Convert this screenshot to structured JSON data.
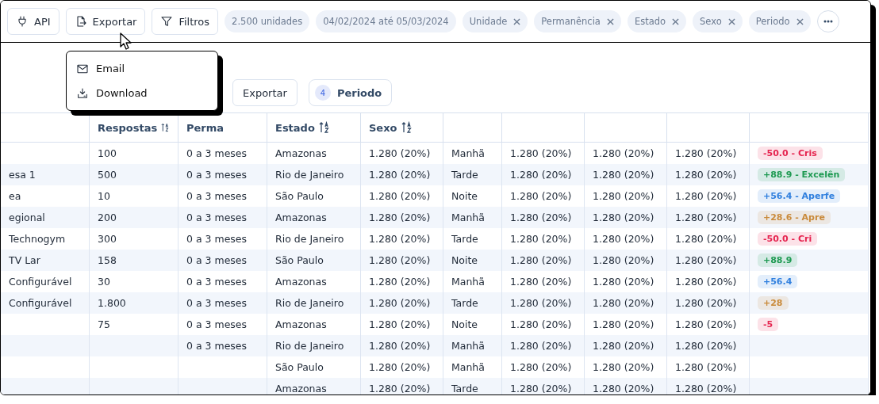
{
  "toolbar": {
    "buttons": [
      {
        "kind": "api",
        "label": "API"
      },
      {
        "kind": "export",
        "label": "Exportar"
      },
      {
        "kind": "filter",
        "label": "Filtros"
      }
    ],
    "chips": [
      {
        "label": "2.500 unidades",
        "removable": false
      },
      {
        "label": "04/02/2024 até 05/03/2024",
        "removable": false
      },
      {
        "label": "Unidade",
        "removable": true
      },
      {
        "label": "Permanência",
        "removable": true
      },
      {
        "label": "Estado",
        "removable": true
      },
      {
        "label": "Sexo",
        "removable": true
      },
      {
        "label": "Periodo",
        "removable": true
      }
    ]
  },
  "export_menu": {
    "items": [
      {
        "kind": "email",
        "label": "Email"
      },
      {
        "kind": "download",
        "label": "Download"
      }
    ]
  },
  "table_toolbar": {
    "export_label": "Exportar",
    "filter": {
      "count": "4",
      "label": "Periodo"
    }
  },
  "table": {
    "columns": [
      {
        "sortable": false
      },
      {
        "label": "Respostas",
        "sortable": true
      },
      {
        "label": "Perma",
        "sortable": false
      },
      {
        "label": "Estado",
        "sortable": true
      },
      {
        "label": "Sexo",
        "sortable": true
      },
      {
        "sortable": false
      },
      {
        "sortable": false
      },
      {
        "sortable": false
      },
      {
        "sortable": false
      },
      {
        "sortable": false
      }
    ],
    "rows": [
      {
        "cells": [
          null,
          "100",
          "0 a 3 meses",
          "Amazonas",
          "1.280 (20%)",
          "Manhã",
          "1.280 (20%)",
          "1.280 (20%)",
          "1.280 (20%)"
        ],
        "badge": {
          "text": "-50.0 - Cris",
          "color": "#e5244f"
        }
      },
      {
        "cells": [
          "esa 1",
          "500",
          "0 a 3 meses",
          "Rio de Janeiro",
          "1.280 (20%)",
          "Tarde",
          "1.280 (20%)",
          "1.280 (20%)",
          "1.280 (20%)"
        ],
        "badge": {
          "text": "+88.9 - Excelên",
          "color": "#1e9a52"
        }
      },
      {
        "cells": [
          "ea",
          "10",
          "0 a 3 meses",
          "São Paulo",
          "1.280 (20%)",
          "Noite",
          "1.280 (20%)",
          "1.280 (20%)",
          "1.280 (20%)"
        ],
        "badge": {
          "text": "+56.4 - Aperfe",
          "color": "#2f7fde"
        }
      },
      {
        "cells": [
          "egional",
          "200",
          "0 a 3 meses",
          "Amazonas",
          "1.280 (20%)",
          "Manhã",
          "1.280 (20%)",
          "1.280 (20%)",
          "1.280 (20%)"
        ],
        "badge": {
          "text": "+28.6 - Apre",
          "color": "#c98a3a"
        }
      },
      {
        "cells": [
          "Technogym",
          "300",
          "0 a 3 meses",
          "Rio de Janeiro",
          "1.280 (20%)",
          "Tarde",
          "1.280 (20%)",
          "1.280 (20%)",
          "1.280 (20%)"
        ],
        "badge": {
          "text": "-50.0 - Cri",
          "color": "#e5244f"
        }
      },
      {
        "cells": [
          "TV Lar",
          "158",
          "0 a 3 meses",
          "São Paulo",
          "1.280 (20%)",
          "Noite",
          "1.280 (20%)",
          "1.280 (20%)",
          "1.280 (20%)"
        ],
        "badge": {
          "text": "+88.9",
          "color": "#1e9a52"
        }
      },
      {
        "cells": [
          "Configurável",
          "30",
          "0 a 3 meses",
          "Amazonas",
          "1.280 (20%)",
          "Manhã",
          "1.280 (20%)",
          "1.280 (20%)",
          "1.280 (20%)"
        ],
        "badge": {
          "text": "+56.4",
          "color": "#2f7fde"
        }
      },
      {
        "cells": [
          "Configurável",
          "1.800",
          "0 a 3 meses",
          "Rio de Janeiro",
          "1.280 (20%)",
          "Tarde",
          "1.280 (20%)",
          "1.280 (20%)",
          "1.280 (20%)"
        ],
        "badge": {
          "text": "+28",
          "color": "#c98a3a"
        }
      },
      {
        "cells": [
          null,
          "75",
          "0 a 3 meses",
          "Amazonas",
          "1.280 (20%)",
          "Noite",
          "1.280 (20%)",
          "1.280 (20%)",
          "1.280 (20%)"
        ],
        "badge": {
          "text": "-5",
          "color": "#e5244f"
        }
      },
      {
        "cells": [
          null,
          null,
          "0 a 3 meses",
          "Rio de Janeiro",
          "1.280 (20%)",
          "Manhã",
          "1.280 (20%)",
          "1.280 (20%)",
          "1.280 (20%)"
        ]
      },
      {
        "cells": [
          null,
          null,
          null,
          "São Paulo",
          "1.280 (20%)",
          "Manhã",
          "1.280 (20%)",
          "1.280 (20%)",
          "1.280 (20%)"
        ]
      },
      {
        "cells": [
          null,
          null,
          null,
          "Amazonas",
          "1.280 (20%)",
          "Tarde",
          "1.280 (20%)",
          "1.280 (20%)",
          "1.280 (20%)"
        ]
      }
    ]
  }
}
